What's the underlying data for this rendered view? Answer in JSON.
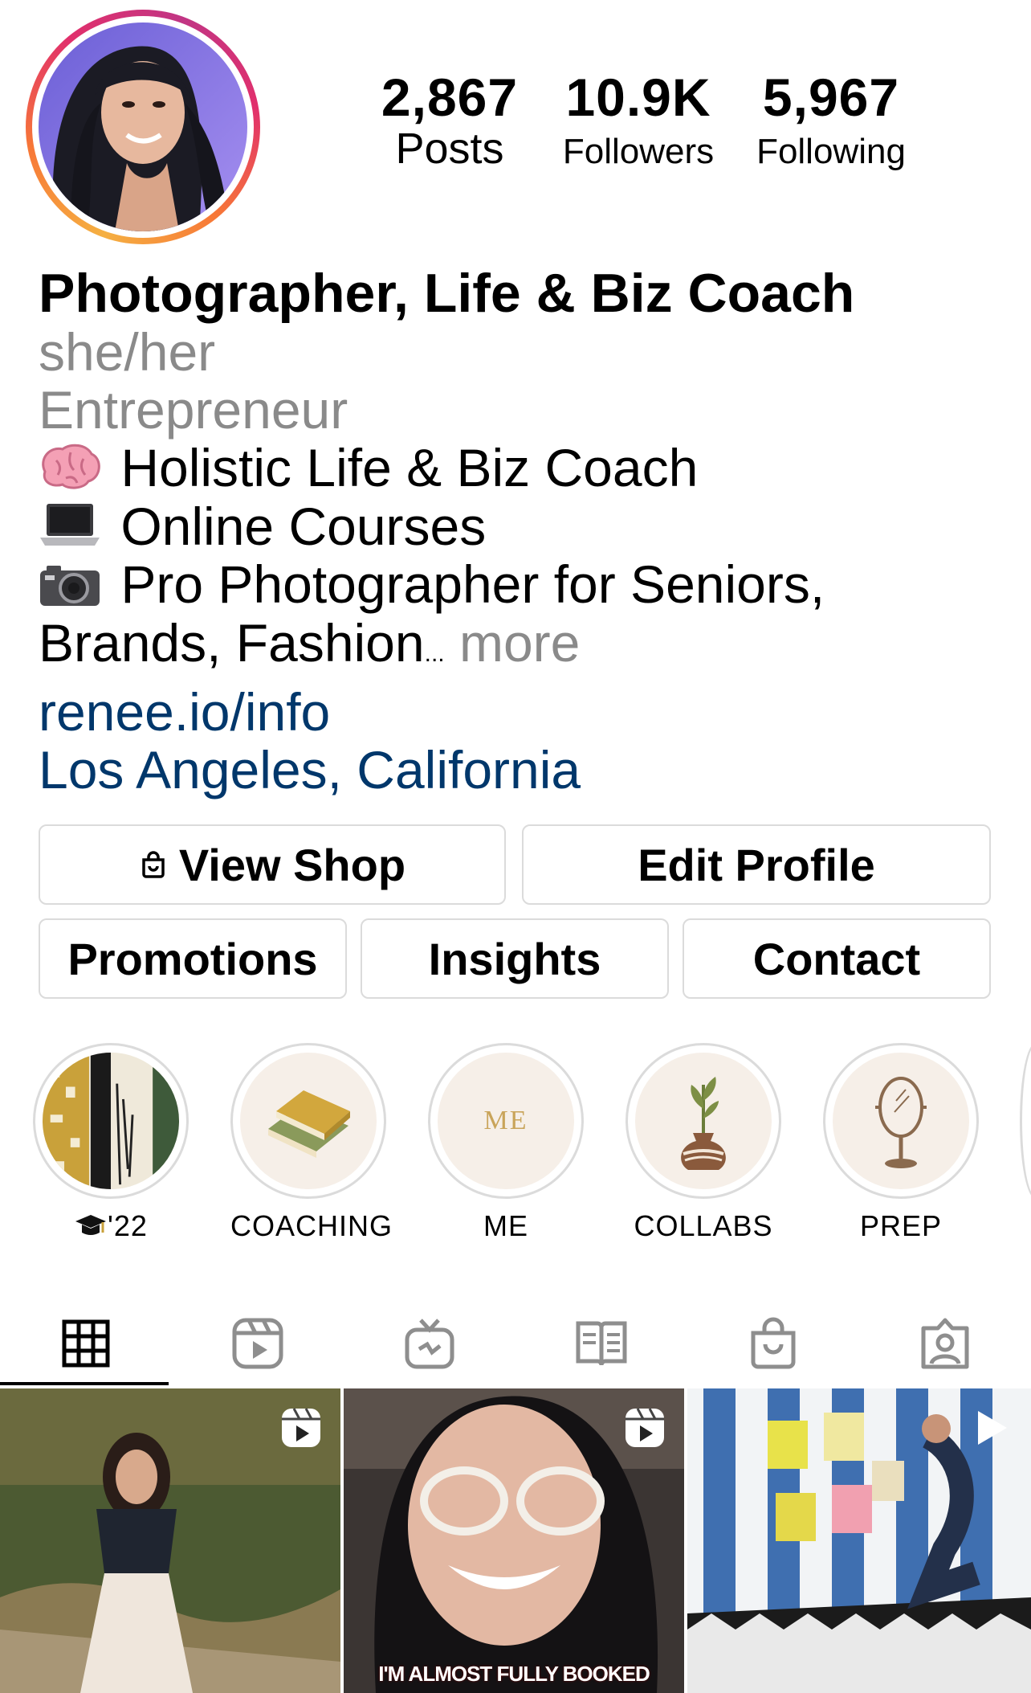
{
  "stats": {
    "posts": {
      "value": "2,867",
      "label": "Posts"
    },
    "followers": {
      "value": "10.9K",
      "label": "Followers"
    },
    "following": {
      "value": "5,967",
      "label": "Following"
    }
  },
  "bio": {
    "name": "Photographer, Life & Biz Coach",
    "pronouns": "she/her",
    "category": "Entrepreneur",
    "lines": [
      {
        "icon": "brain-icon",
        "text": "Holistic Life & Biz Coach"
      },
      {
        "icon": "laptop-icon",
        "text": "Online Courses"
      },
      {
        "icon": "camera-icon",
        "text": "Pro Photographer for Seniors,"
      }
    ],
    "continuation": "Brands, Fashion",
    "ellipsis": "...",
    "more": "more",
    "link": "renee.io/info",
    "location": "Los Angeles, California"
  },
  "buttons": {
    "view_shop": "View Shop",
    "edit_profile": "Edit Profile",
    "promotions": "Promotions",
    "insights": "Insights",
    "contact": "Contact"
  },
  "highlights": [
    {
      "label": "'22",
      "icon": "graduation-cap-icon"
    },
    {
      "label": "COACHING",
      "icon": "book-icon"
    },
    {
      "label": "ME",
      "image_text": "ME"
    },
    {
      "label": "COLLABS",
      "icon": "plant-vase-icon"
    },
    {
      "label": "PREP",
      "icon": "mirror-icon"
    }
  ],
  "tabs": [
    "grid-icon",
    "reels-icon",
    "igtv-icon",
    "guides-icon",
    "shop-icon",
    "tagged-icon"
  ],
  "posts": [
    {
      "type": "reel",
      "caption": ""
    },
    {
      "type": "reel",
      "caption": "I'M ALMOST FULLY BOOKED"
    },
    {
      "type": "video",
      "caption": ""
    }
  ],
  "colors": {
    "link": "#00376b",
    "secondary_text": "#8a8a8a",
    "border": "#dbdbdb"
  }
}
